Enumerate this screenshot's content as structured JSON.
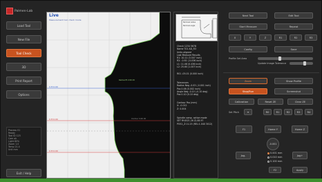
{
  "app": {
    "logo_text": "Palmen-Lab",
    "accent": "#c8531f",
    "status_strip_color": "#3f8f2e"
  },
  "left_nav": {
    "items": [
      {
        "label": "Load Tool",
        "active": false
      },
      {
        "label": "New File",
        "active": false
      },
      {
        "label": "Tool Check",
        "active": true
      },
      {
        "label": "3D",
        "active": false
      },
      {
        "label": "Print Report",
        "active": false
      },
      {
        "label": "Options",
        "active": false
      }
    ],
    "info_lines": [
      "Process 01",
      "Ready",
      "Tool ID 123",
      "Cam ok",
      "Light 80%",
      "Zoom 1.0",
      "Temp 21.4",
      "Unit mm"
    ],
    "exit_label": "Exit / Help"
  },
  "viewport": {
    "title": "Live",
    "subtitle": "Measurement tool check mode",
    "line_labels": {
      "blue": "0.H:0.00",
      "red_top": "0.H:0.00",
      "red_bottom": "0.H:0.00",
      "contour_a": "Radius fit 2.00 d0",
      "contour_b": "Contour 0.00 d0"
    }
  },
  "info_panel": {
    "drawing_labels": [
      "Nominal radius",
      "Nominal angle"
    ],
    "block1": [
      "Check 1234 5678",
      "Name T01 AD_R3",
      "Units aligned",
      "Last Measure Results",
      "R1: 10.11 (3.507 inch)",
      "R2: -0.92 (-0.036 inch)",
      "L1: 11.08 (0.436 inch)",
      "L2: 25.60 (1.007 inch)"
    ],
    "block2": [
      "R01 -05.01 (0.000 inch)"
    ],
    "block3": [
      "Tolerances",
      "Radius   Neg  -0.03 (-0.001 inch)",
      "         Pos   0.06 (0.002 inch)",
      "Angle    Neg  -0.10 (-0.10 deg)",
      "         Pos   0.10 (0.10 deg)"
    ],
    "block4": [
      "Contour Pos (mm)",
      "X:  -0.012",
      "Z:   0.004"
    ],
    "block5": [
      "Spindle comp. active mode",
      "SET  RH/021.26  Z/-08.97",
      "POS1_Z:11.23 (REL:1.040 3012)"
    ]
  },
  "controls": {
    "top_buttons": [
      "Next Tool",
      "Edit Tool",
      "Start Measure",
      "Repeat"
    ],
    "mini_buttons": [
      "X",
      "Y",
      "Z",
      "R1",
      "R2",
      "R3"
    ],
    "config_buttons": [
      "Config",
      "Save"
    ],
    "slider_labels": [
      "Profile Set Area",
      "Update Image Tolerance"
    ],
    "row_a": [
      "Zoom",
      "Show Profile"
    ],
    "row_b": [
      "Stop/Run",
      "Screenshot"
    ],
    "row_c": [
      "Calibration",
      "Reset ZE",
      "Clear ZE"
    ],
    "small_row_label": "Set Pitch",
    "small_row_buttons": [
      "R0",
      "R1",
      "R2",
      "R3",
      "R4"
    ],
    "nav_buttons": [
      "F1",
      "Home Y",
      "Home Z"
    ],
    "bottom_buttons": [
      "Jog-",
      "F2",
      "Jog+",
      "Apply"
    ],
    "circle_label": "-0.001",
    "radios": [
      {
        "label": "0.001 mm",
        "on": true
      },
      {
        "label": "0.010 mm",
        "on": false
      },
      {
        "label": "0.100 mm",
        "on": false
      }
    ]
  }
}
